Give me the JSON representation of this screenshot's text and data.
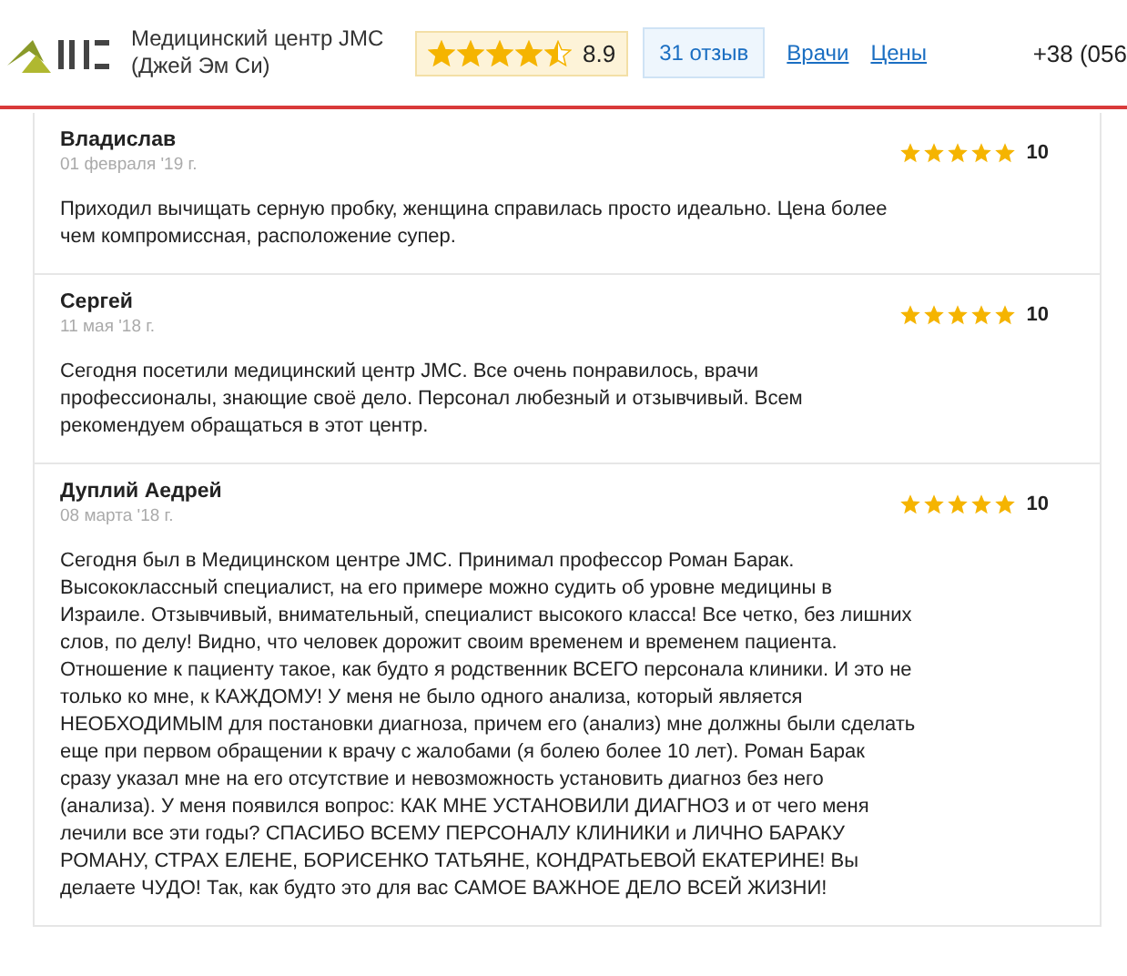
{
  "header": {
    "clinic_name": "Медицинский центр JMC (Джей Эм Си)",
    "rating": {
      "stars": 4.5,
      "score": "8.9"
    },
    "reviews_button": "31 отзыв",
    "links": [
      "Врачи",
      "Цены"
    ],
    "phone": "+38 (056"
  },
  "reviews": [
    {
      "author": "Владислав",
      "date": "01 февраля '19 г.",
      "stars": 5,
      "score": "10",
      "text": "Приходил вычищать серную пробку, женщина справилась просто идеально. Цена более чем компромиссная, расположение супер."
    },
    {
      "author": "Сергей",
      "date": "11 мая '18 г.",
      "stars": 5,
      "score": "10",
      "text": "Сегодня посетили медицинский центр JMC. Все очень понравилось, врачи профессионалы, знающие своё дело. Персонал любезный и отзывчивый. Всем рекомендуем обращаться в этот центр."
    },
    {
      "author": "Дуплий Аедрей",
      "date": "08 марта '18 г.",
      "stars": 5,
      "score": "10",
      "text": "Сегодня был в Медицинском центре JMC. Принимал профессор Роман Барак. Высококлассный специалист, на его примере можно судить об уровне медицины в Израиле. Отзывчивый, внимательный, специалист высокого класса! Все четко, без лишних слов, по делу! Видно, что человек дорожит своим временем и временем пациента. Отношение к пациенту такое, как будто я родственник ВСЕГО персонала клиники. И это не только ко мне, к КАЖДОМУ! У меня не было одного анализа, который является НЕОБХОДИМЫМ для постановки диагноза, причем его (анализ) мне должны были сделать еще при первом обращении к врачу с жалобами (я болею более 10 лет). Роман Барак сразу указал мне на его отсутствие и невозможность установить диагноз без него (анализа). У меня появился вопрос: КАК МНЕ УСТАНОВИЛИ ДИАГНОЗ и от чего меня лечили все эти годы? СПАСИБО ВСЕМУ ПЕРСОНАЛУ КЛИНИКИ и ЛИЧНО БАРАКУ РОМАНУ, СТРАХ ЕЛЕНЕ, БОРИСЕНКО ТАТЬЯНЕ, КОНДРАТЬЕВОЙ ЕКАТЕРИНЕ! Вы делаете ЧУДО! Так, как будто это для вас САМОЕ ВАЖНОЕ ДЕЛО ВСЕЙ ЖИЗНИ!"
    }
  ]
}
